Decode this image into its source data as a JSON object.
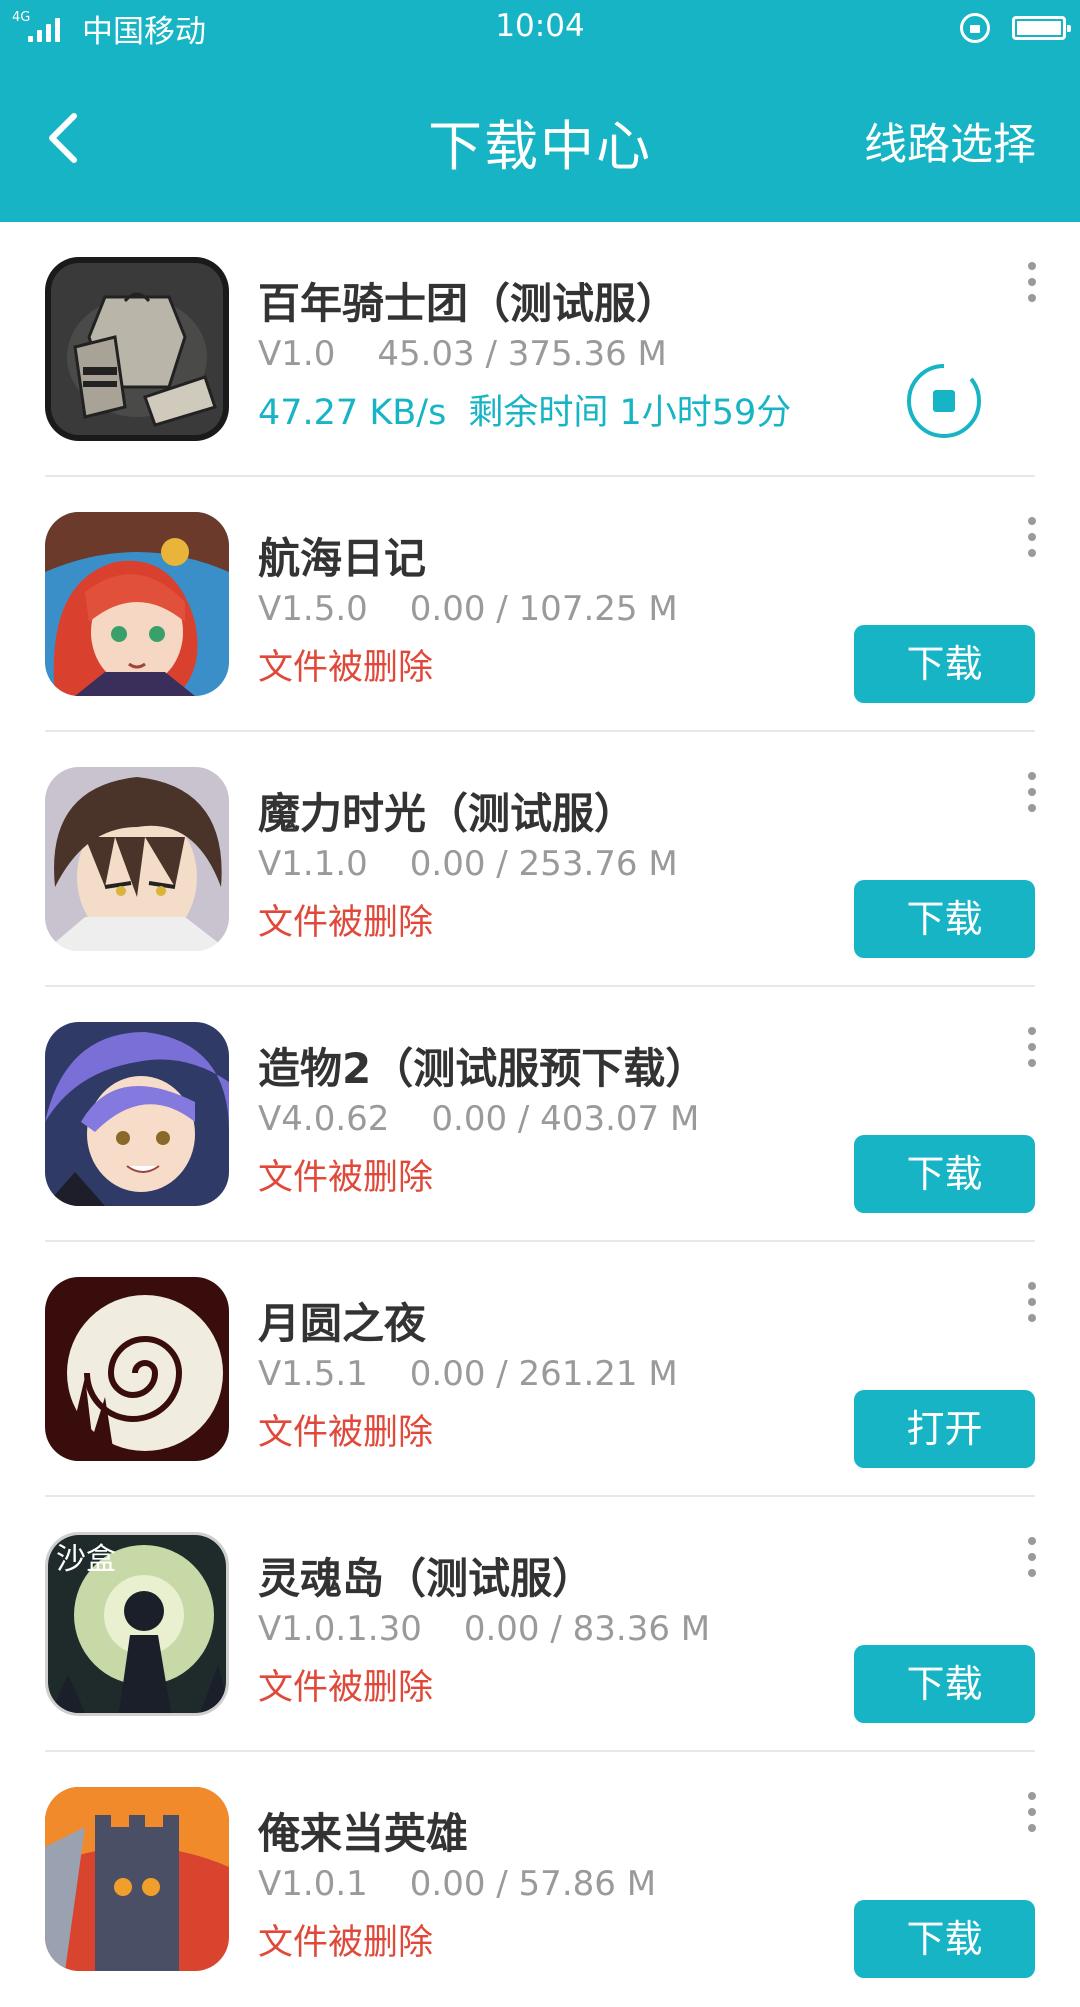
{
  "status_bar": {
    "network": "4G",
    "carrier": "中国移动",
    "time": "10:04"
  },
  "header": {
    "title": "下载中心",
    "right_action": "线路选择",
    "back_icon": "chevron-left-icon"
  },
  "colors": {
    "accent": "#16b4c4",
    "deleted": "#e0493a",
    "title_text": "#333333",
    "meta_text": "#9a9a9a"
  },
  "downloads": [
    {
      "name": "百年骑士团（测试服）",
      "version": "V1.0",
      "size": "45.03 / 375.36 M",
      "state": "downloading",
      "speed": "47.27 KB/s",
      "remaining": "剩余时间 1小时59分",
      "action_icon": "stop-icon"
    },
    {
      "name": "航海日记",
      "version": "V1.5.0",
      "size": "0.00 / 107.25 M",
      "state": "deleted",
      "status_text": "文件被删除",
      "action": "下载"
    },
    {
      "name": "魔力时光（测试服）",
      "version": "V1.1.0",
      "size": "0.00 / 253.76 M",
      "state": "deleted",
      "status_text": "文件被删除",
      "action": "下载"
    },
    {
      "name": "造物2（测试服预下载）",
      "version": "V4.0.62",
      "size": "0.00 / 403.07 M",
      "state": "deleted",
      "status_text": "文件被删除",
      "action": "下载"
    },
    {
      "name": "月圆之夜",
      "version": "V1.5.1",
      "size": "0.00 / 261.21 M",
      "state": "deleted",
      "status_text": "文件被删除",
      "action": "打开"
    },
    {
      "name": "灵魂岛（测试服）",
      "version": "V1.0.1.30",
      "size": "0.00 / 83.36 M",
      "state": "deleted",
      "status_text": "文件被删除",
      "action": "下载",
      "icon_badge": "沙盒"
    },
    {
      "name": "俺来当英雄",
      "version": "V1.0.1",
      "size": "0.00 / 57.86 M",
      "state": "deleted",
      "status_text": "文件被删除",
      "action": "下载"
    }
  ]
}
